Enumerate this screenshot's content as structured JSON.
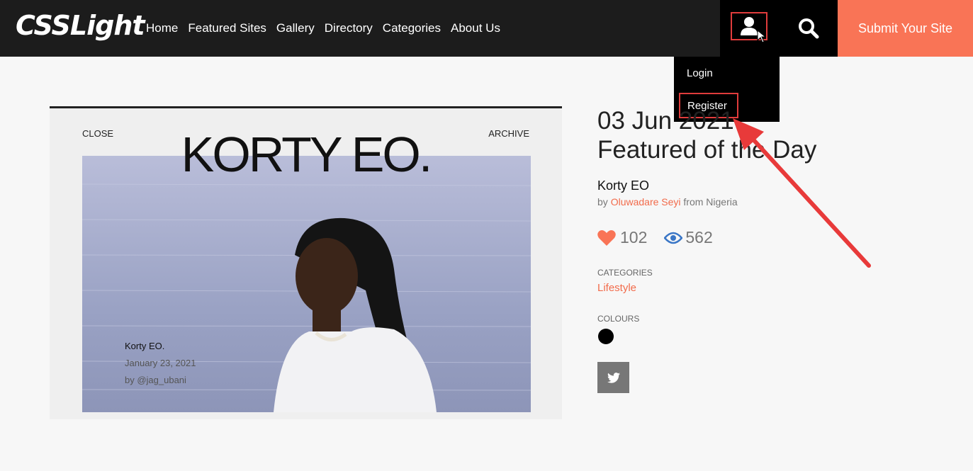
{
  "header": {
    "logo": "CSSLight",
    "nav": [
      "Home",
      "Featured Sites",
      "Gallery",
      "Directory",
      "Categories",
      "About Us"
    ],
    "submit_label": "Submit Your Site"
  },
  "dropdown": {
    "login": "Login",
    "register": "Register"
  },
  "preview": {
    "close": "CLOSE",
    "archive": "ARCHIVE",
    "brand": "KORTY EO.",
    "name": "Korty EO.",
    "date": "January 23, 2021",
    "by": "by @jag_ubani"
  },
  "featured": {
    "date": "03 Jun 2021",
    "title": "Featured of the Day",
    "site_name": "Korty EO",
    "by": "by",
    "author": "Oluwadare Seyi",
    "from": "from Nigeria",
    "likes": "102",
    "views": "562",
    "categories_label": "CATEGORIES",
    "category": "Lifestyle",
    "colours_label": "COLOURS"
  },
  "colors": {
    "accent": "#f97456",
    "link": "#f26b4b",
    "highlight": "#e03c3c",
    "swatch": "#000000"
  },
  "icons": [
    "user-icon",
    "cursor-icon",
    "search-icon",
    "heart-icon",
    "eye-icon",
    "twitter-icon",
    "arrow-annotation"
  ]
}
